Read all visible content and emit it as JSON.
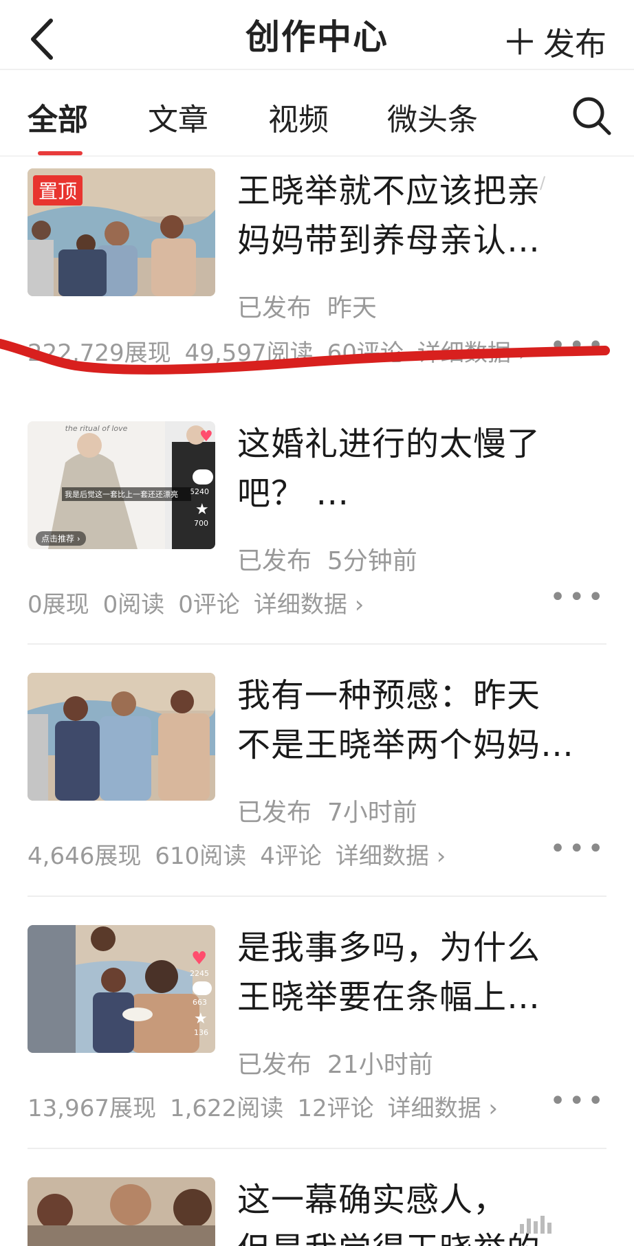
{
  "header": {
    "title": "创作中心",
    "publish_label": "发布"
  },
  "tabs": [
    {
      "label": "全部",
      "active": true
    },
    {
      "label": "文章"
    },
    {
      "label": "视频"
    },
    {
      "label": "微头条"
    }
  ],
  "items": [
    {
      "title_line1": "王晓举就不应该把亲",
      "title_line2": "妈妈带到养母亲认…",
      "badge": "置顶",
      "status": "已发布",
      "time": "昨天",
      "impressions": "222,729展现",
      "reads": "49,597阅读",
      "comments": "60评论",
      "details": "详细数据 ›"
    },
    {
      "title_line1": "这婚礼进行的太慢了",
      "title_line2": "吧？ …",
      "status": "已发布",
      "time": "5分钟前",
      "impressions": "0展现",
      "reads": "0阅读",
      "comments": "0评论",
      "details": "详细数据 ›",
      "thumb_caption": "我是后觉这一套比上一套还还漂亮",
      "thumb_recommend": "点击推荐 ›",
      "thumb_count1": "5240",
      "thumb_count2": "700",
      "thumb_bg_text": "the ritual of love"
    },
    {
      "title_line1": "我有一种预感：昨天",
      "title_line2": "不是王晓举两个妈妈…",
      "status": "已发布",
      "time": "7小时前",
      "impressions": "4,646展现",
      "reads": "610阅读",
      "comments": "4评论",
      "details": "详细数据 ›"
    },
    {
      "title_line1": "是我事多吗，为什么",
      "title_line2": "王晓举要在条幅上…",
      "status": "已发布",
      "time": "21小时前",
      "impressions": "13,967展现",
      "reads": "1,622阅读",
      "comments": "12评论",
      "details": "详细数据 ›",
      "thumb_count1": "2245",
      "thumb_count2": "663",
      "thumb_count3": "136"
    },
    {
      "title_line1": "这一幕确实感人，",
      "title_line2": "但是我觉得王晓举的"
    }
  ],
  "colors": {
    "accent": "#e83b3b",
    "muted": "#999999"
  }
}
